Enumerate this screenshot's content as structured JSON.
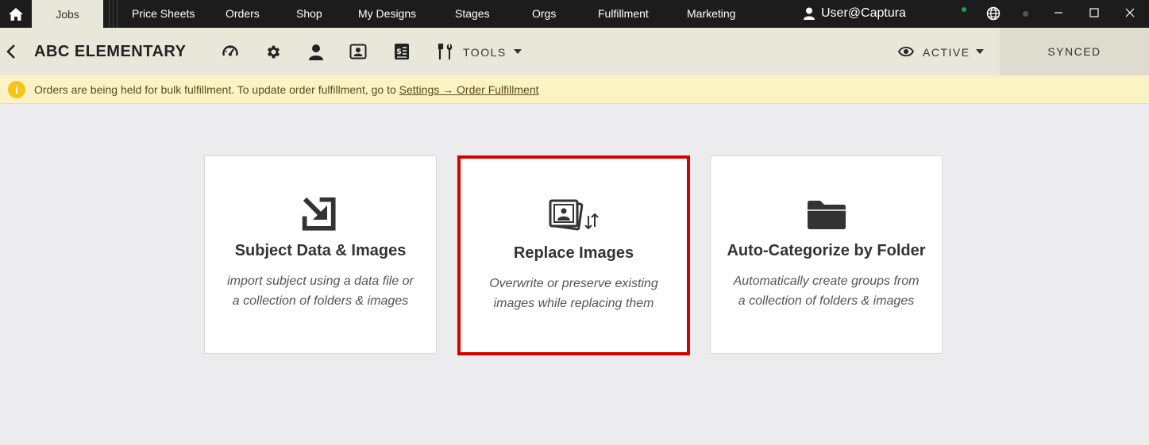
{
  "topnav": {
    "tabs": [
      {
        "label": "Jobs"
      },
      {
        "label": "Price Sheets"
      },
      {
        "label": "Orders"
      },
      {
        "label": "Shop"
      },
      {
        "label": "My Designs"
      },
      {
        "label": "Stages"
      },
      {
        "label": "Orgs"
      },
      {
        "label": "Fulfillment"
      },
      {
        "label": "Marketing"
      }
    ],
    "user": "User@Captura",
    "icons": [
      "home-icon",
      "user-icon",
      "globe-icon",
      "minimize-icon",
      "maximize-icon",
      "close-icon"
    ]
  },
  "toolbar": {
    "title": "ABC ELEMENTARY",
    "tools_label": "TOOLS",
    "status_label": "ACTIVE",
    "sync_label": "SYNCED",
    "icons": [
      "back-icon",
      "dashboard-icon",
      "gear-icon",
      "person-icon",
      "photo-id-icon",
      "price-list-icon",
      "tools-icon",
      "eye-icon"
    ]
  },
  "banner": {
    "text": "Orders are being held for bulk fulfillment. To update order fulfillment, go to ",
    "link": "Settings → Order Fulfillment",
    "color": "#fcf3c4"
  },
  "cards": [
    {
      "title": "Subject Data & Images",
      "desc1": "import subject using a data file or",
      "desc2": "a collection of folders & images",
      "icon": "import-arrow-icon"
    },
    {
      "title": "Replace Images",
      "desc1": "Overwrite or preserve existing",
      "desc2": "images while replacing them",
      "icon": "replace-images-icon",
      "highlighted": true
    },
    {
      "title": "Auto-Categorize by Folder",
      "desc1": "Automatically create groups from",
      "desc2": "a collection of folders & images",
      "icon": "folder-icon"
    }
  ],
  "colors": {
    "highlight": "#d40000",
    "topnav": "#1c1c1c",
    "toolbar": "#e9e6da"
  }
}
